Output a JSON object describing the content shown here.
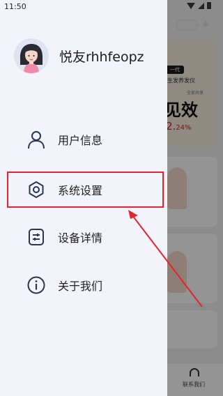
{
  "status_bar": {
    "time": "11:50"
  },
  "drawer": {
    "username": "悦友rhhfeopz",
    "menu": [
      {
        "key": "user-info",
        "label": "用户信息",
        "icon": "person-icon"
      },
      {
        "key": "system-settings",
        "label": "系统设置",
        "icon": "gear-icon",
        "highlighted": true
      },
      {
        "key": "device-details",
        "label": "设备详情",
        "icon": "device-icon"
      },
      {
        "key": "about-us",
        "label": "关于我们",
        "icon": "info-icon"
      }
    ]
  },
  "background": {
    "promo_tag": "一代",
    "promo_line": "生发养发仪",
    "promo_label": "全家共享",
    "promo_big": "见效",
    "promo_pct": "2.",
    "promo_pct_small": "24%",
    "tab_contact": "联系我们"
  },
  "colors": {
    "highlight": "#e3242b",
    "arrow": "#e3242b",
    "drawer_bg": "#f3f4fb",
    "icon": "#2b3450"
  }
}
